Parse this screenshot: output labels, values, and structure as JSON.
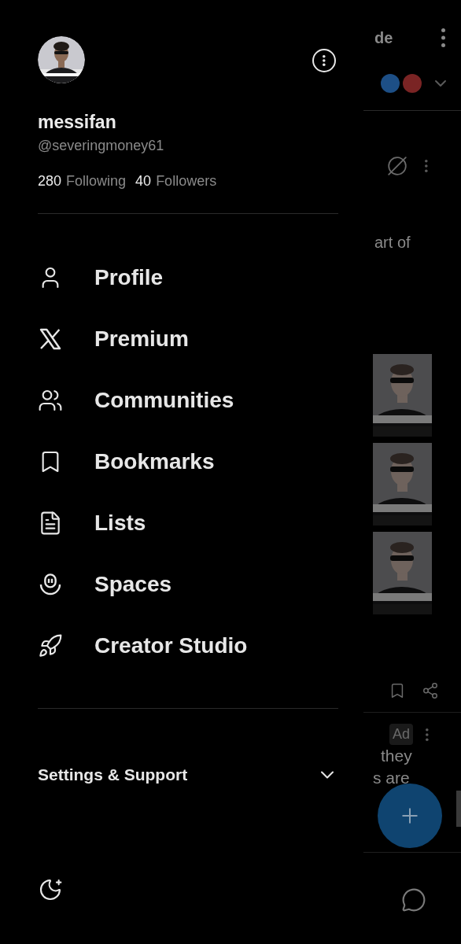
{
  "drawer": {
    "profile": {
      "name": "messifan",
      "handle": "@severingmoney61",
      "following_count": "280",
      "following_label": "Following",
      "followers_count": "40",
      "followers_label": "Followers"
    },
    "menu": [
      {
        "kind": "profile",
        "label": "Profile"
      },
      {
        "kind": "premium",
        "label": "Premium"
      },
      {
        "kind": "communities",
        "label": "Communities"
      },
      {
        "kind": "bookmarks",
        "label": "Bookmarks"
      },
      {
        "kind": "lists",
        "label": "Lists"
      },
      {
        "kind": "spaces",
        "label": "Spaces"
      },
      {
        "kind": "studio",
        "label": "Creator Studio"
      }
    ],
    "settings": {
      "label": "Settings & Support",
      "expanded": false
    }
  },
  "feed": {
    "header_text": "de",
    "post_text": "art of",
    "ad_badge": "Ad",
    "ad_lines": [
      "they",
      "s are"
    ],
    "dots": [
      {
        "color": "#1d4f86"
      },
      {
        "color": "#7a2424"
      }
    ],
    "thumbnails": [
      {
        "kind": "picture"
      },
      {
        "kind": "picture"
      },
      {
        "kind": "picture"
      }
    ]
  }
}
